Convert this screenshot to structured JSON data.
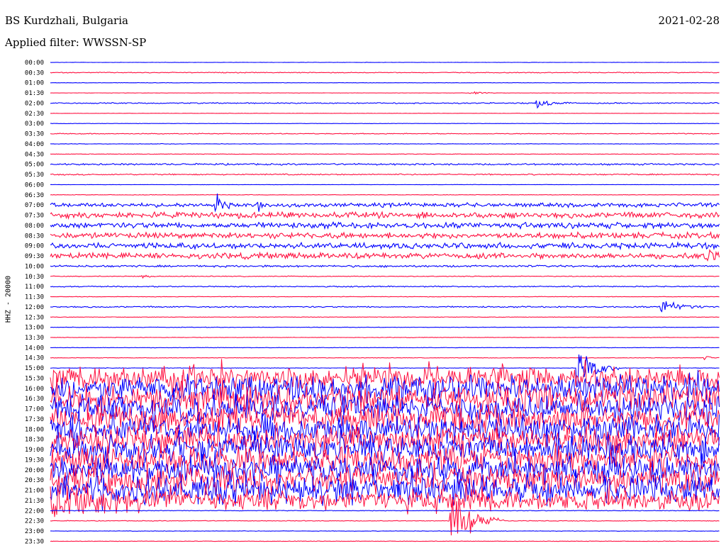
{
  "header": {
    "station": "BS Kurdzhali, Bulgaria",
    "date": "2021-02-28",
    "filter": "Applied filter: WWSSN-SP"
  },
  "chart_data": {
    "type": "line",
    "ylabel": "HHZ - 20000",
    "row_labels": [
      "00:00",
      "00:30",
      "01:00",
      "01:30",
      "02:00",
      "02:30",
      "03:00",
      "03:30",
      "04:00",
      "04:30",
      "05:00",
      "05:30",
      "06:00",
      "06:30",
      "07:00",
      "07:30",
      "08:00",
      "08:30",
      "09:00",
      "09:30",
      "10:00",
      "10:30",
      "11:00",
      "11:30",
      "12:00",
      "12:30",
      "13:00",
      "13:30",
      "14:00",
      "14:30",
      "15:00",
      "15:30",
      "16:00",
      "16:30",
      "17:00",
      "17:30",
      "18:00",
      "18:30",
      "19:00",
      "19:30",
      "20:00",
      "20:30",
      "21:00",
      "21:30",
      "22:00",
      "22:30",
      "23:00",
      "23:30"
    ],
    "colors": {
      "even": "#0000ff",
      "odd": "#ff1040"
    },
    "noise_level": [
      0.2,
      0.5,
      0.2,
      0.2,
      0.7,
      0.2,
      0.2,
      0.5,
      0.3,
      0.3,
      1.0,
      0.8,
      0.2,
      0.3,
      2.5,
      3.5,
      3.5,
      3.5,
      3.5,
      3.5,
      1.2,
      0.5,
      0.7,
      0.3,
      0.8,
      0.3,
      0.3,
      0.3,
      0.3,
      0.3,
      0.3,
      14,
      16,
      16,
      16,
      16,
      16,
      16,
      16,
      16,
      16,
      16,
      16,
      12,
      0.4,
      0.4,
      0.3,
      0.3
    ],
    "events": [
      {
        "row": "01:30",
        "x_fraction": 0.63,
        "amplitude": 2.5,
        "duration": 0.04
      },
      {
        "row": "02:00",
        "x_fraction": 0.73,
        "amplitude": 8,
        "duration": 0.05
      },
      {
        "row": "07:00",
        "x_fraction": 0.25,
        "amplitude": 14,
        "duration": 0.03
      },
      {
        "row": "07:00",
        "x_fraction": 0.31,
        "amplitude": 9,
        "duration": 0.02
      },
      {
        "row": "09:30",
        "x_fraction": 0.98,
        "amplitude": 9,
        "duration": 0.03
      },
      {
        "row": "10:30",
        "x_fraction": 0.14,
        "amplitude": 3,
        "duration": 0.02
      },
      {
        "row": "12:00",
        "x_fraction": 0.915,
        "amplitude": 12,
        "duration": 0.07
      },
      {
        "row": "14:30",
        "x_fraction": 0.98,
        "amplitude": 4,
        "duration": 0.02
      },
      {
        "row": "15:00",
        "x_fraction": 0.79,
        "amplitude": 40,
        "duration": 0.06
      },
      {
        "row": "21:30",
        "x_fraction": 0.0,
        "amplitude": 30,
        "duration": 0.18
      },
      {
        "row": "22:30",
        "x_fraction": 0.6,
        "amplitude": 50,
        "duration": 0.08
      }
    ]
  }
}
